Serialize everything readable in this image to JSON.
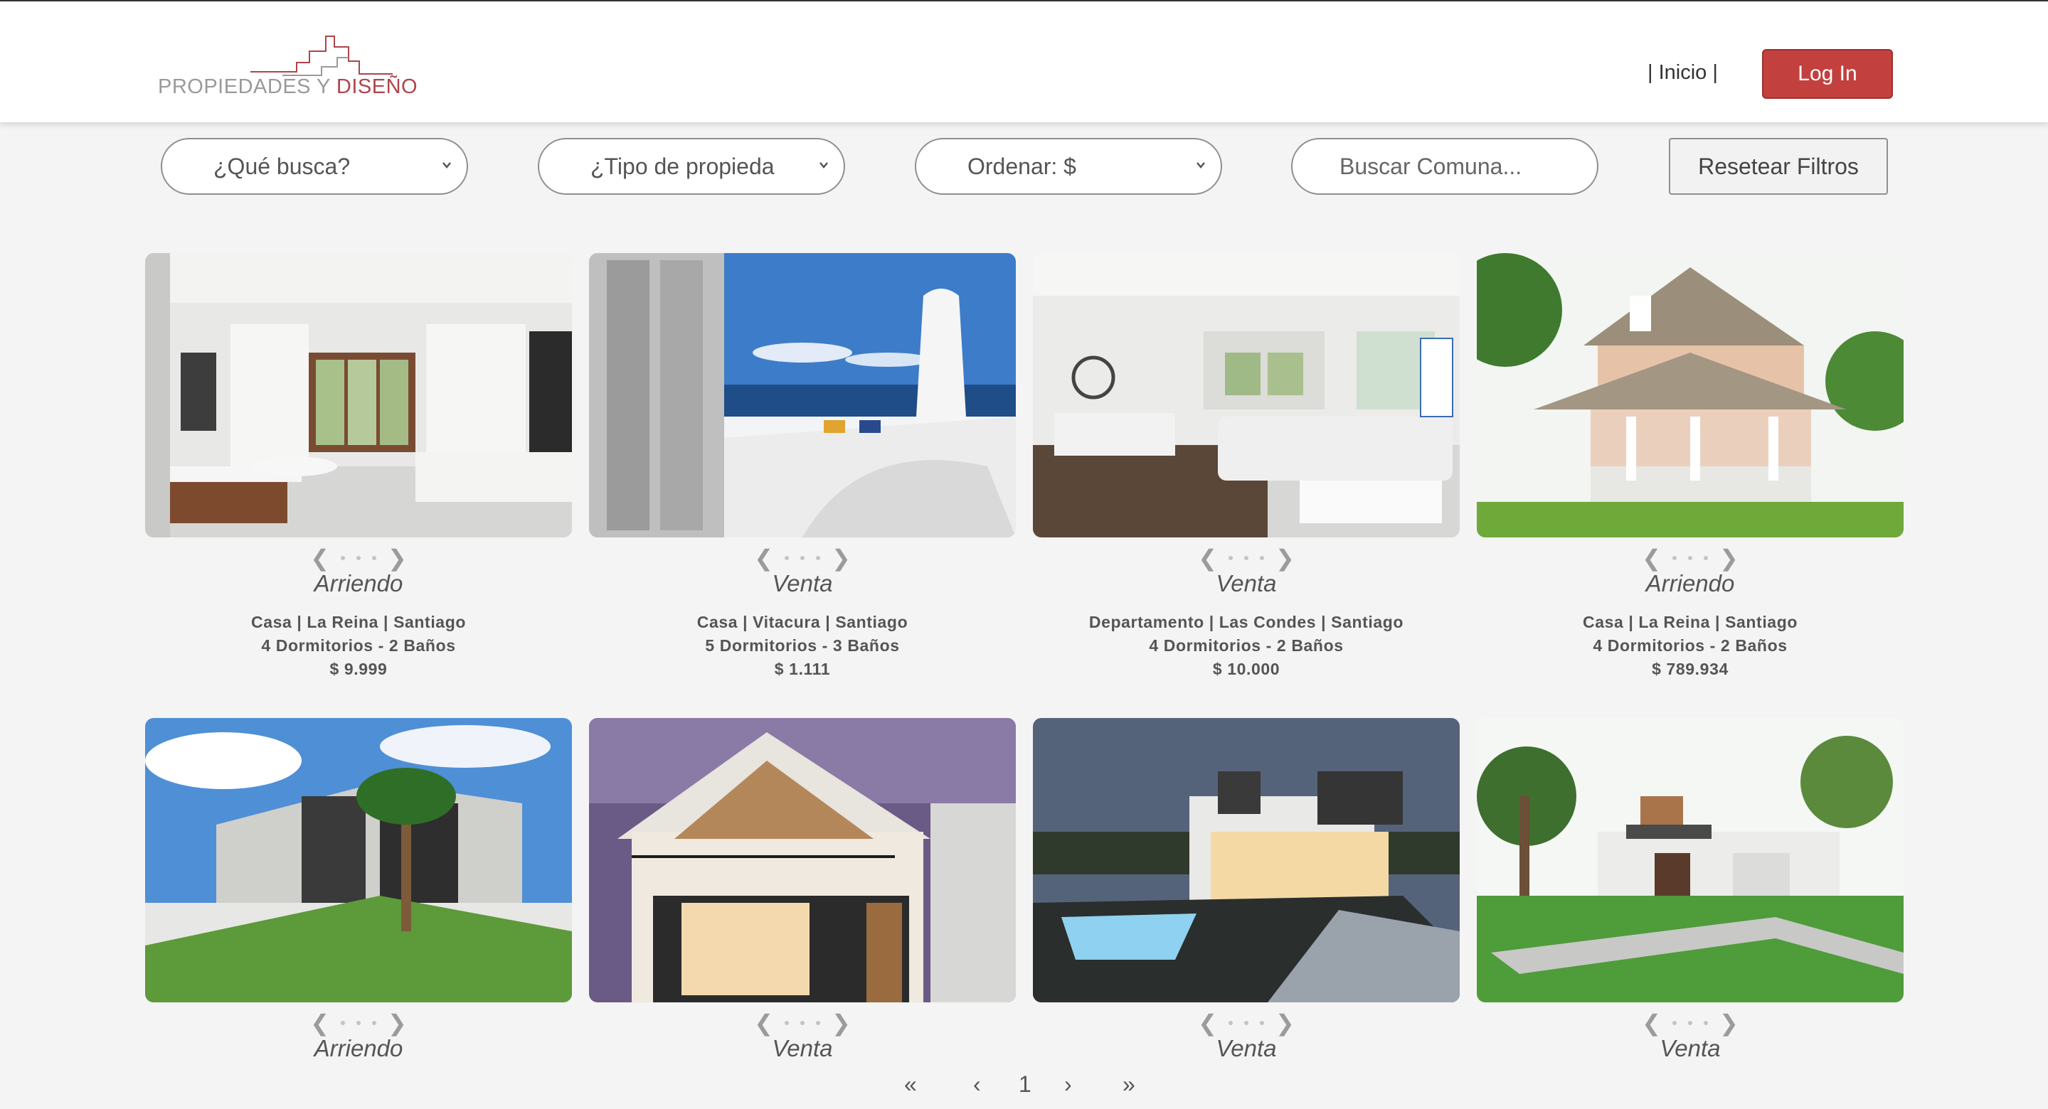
{
  "header": {
    "logo": {
      "text_main": "PROPIEDADES Y ",
      "text_accent": "DISEÑO",
      "accent_color": "#b0444a"
    },
    "nav_inicio": "| Inicio |",
    "login_label": "Log In",
    "login_color": "#c2413f"
  },
  "filters": {
    "que_busca": "¿Qué busca?",
    "tipo_propiedad": "¿Tipo de propieda",
    "ordenar": "Ordenar: $",
    "comuna_placeholder": "Buscar Comuna...",
    "reset_label": "Resetear Filtros"
  },
  "carousel": {
    "prev_icon": "chevron-left-icon",
    "next_icon": "chevron-right-icon",
    "prev": "❮",
    "next": "❯"
  },
  "listings": [
    {
      "status": "Arriendo",
      "line1": "Casa | La Reina | Santiago",
      "line2": "4 Dormitorios - 2 Baños",
      "price": "$ 9.999"
    },
    {
      "status": "Venta",
      "line1": "Casa | Vitacura | Santiago",
      "line2": "5 Dormitorios - 3 Baños",
      "price": "$ 1.111"
    },
    {
      "status": "Venta",
      "line1": "Departamento | Las Condes | Santiago",
      "line2": "4 Dormitorios - 2 Baños",
      "price": "$ 10.000"
    },
    {
      "status": "Arriendo",
      "line1": "Casa | La Reina | Santiago",
      "line2": "4 Dormitorios - 2 Baños",
      "price": "$ 789.934"
    },
    {
      "status": "Arriendo"
    },
    {
      "status": "Venta"
    },
    {
      "status": "Venta"
    },
    {
      "status": "Venta"
    }
  ],
  "pagination": {
    "first": "«",
    "prev": "‹",
    "current": "1",
    "next": "›",
    "last": "»"
  }
}
